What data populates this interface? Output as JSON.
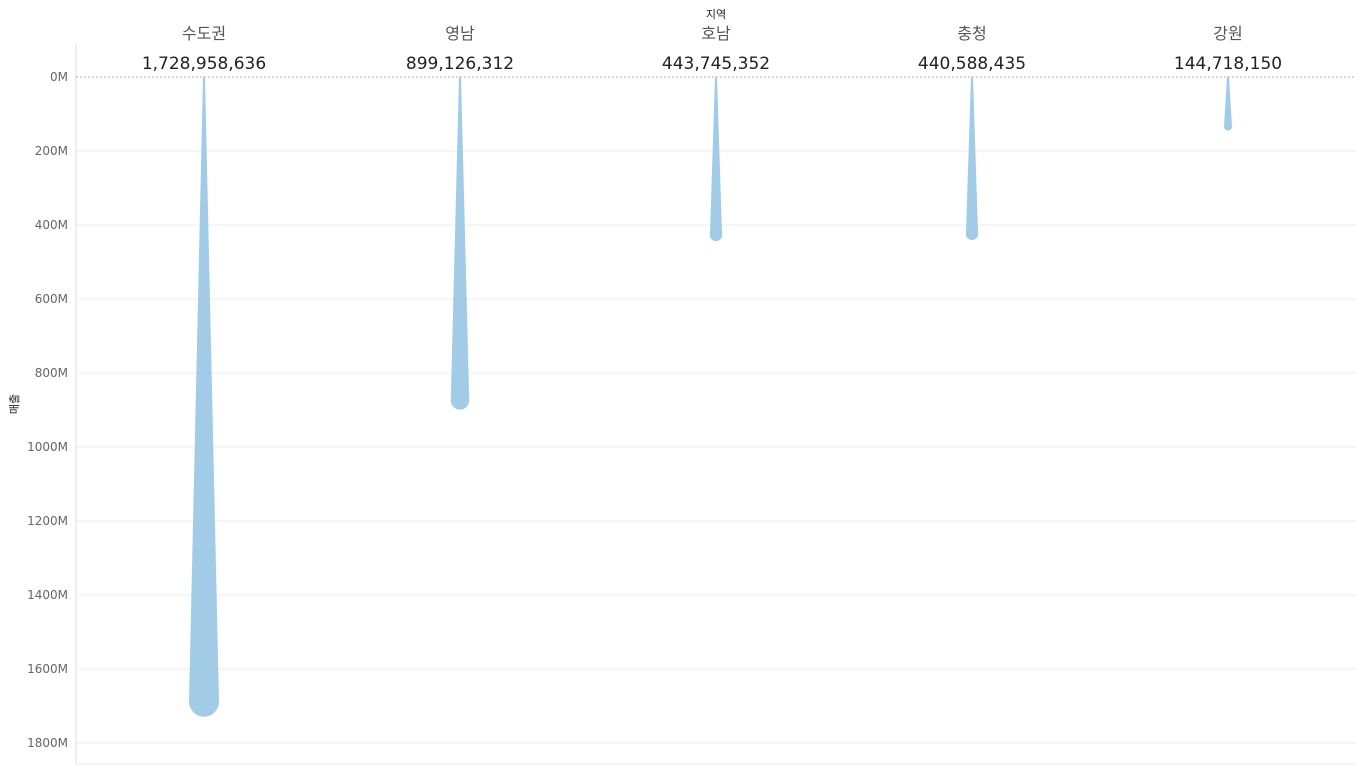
{
  "chart_data": {
    "type": "bar",
    "column_header": "지역",
    "ylabel": "매출",
    "categories": [
      "수도권",
      "영남",
      "호남",
      "충청",
      "강원"
    ],
    "values": [
      1728958636,
      899126312,
      443745352,
      440588435,
      144718150
    ],
    "value_labels": [
      "1,728,958,636",
      "899,126,312",
      "443,745,352",
      "440,588,435",
      "144,718,150"
    ],
    "ylim": [
      0,
      1850000000
    ],
    "y_ticks": [
      0,
      200000000,
      400000000,
      600000000,
      800000000,
      1000000000,
      1200000000,
      1400000000,
      1600000000,
      1800000000
    ],
    "y_tick_labels": [
      "0M",
      "200M",
      "400M",
      "600M",
      "800M",
      "1000M",
      "1200M",
      "1400M",
      "1600M",
      "1800M"
    ],
    "y_axis_inverted": true,
    "grid": true,
    "mark_shape": "teardrop",
    "colors": {
      "mark": "#a2cbe8",
      "grid": "#ececec",
      "zero_line": "#b0b0b0",
      "axis": "#dddddd"
    }
  }
}
